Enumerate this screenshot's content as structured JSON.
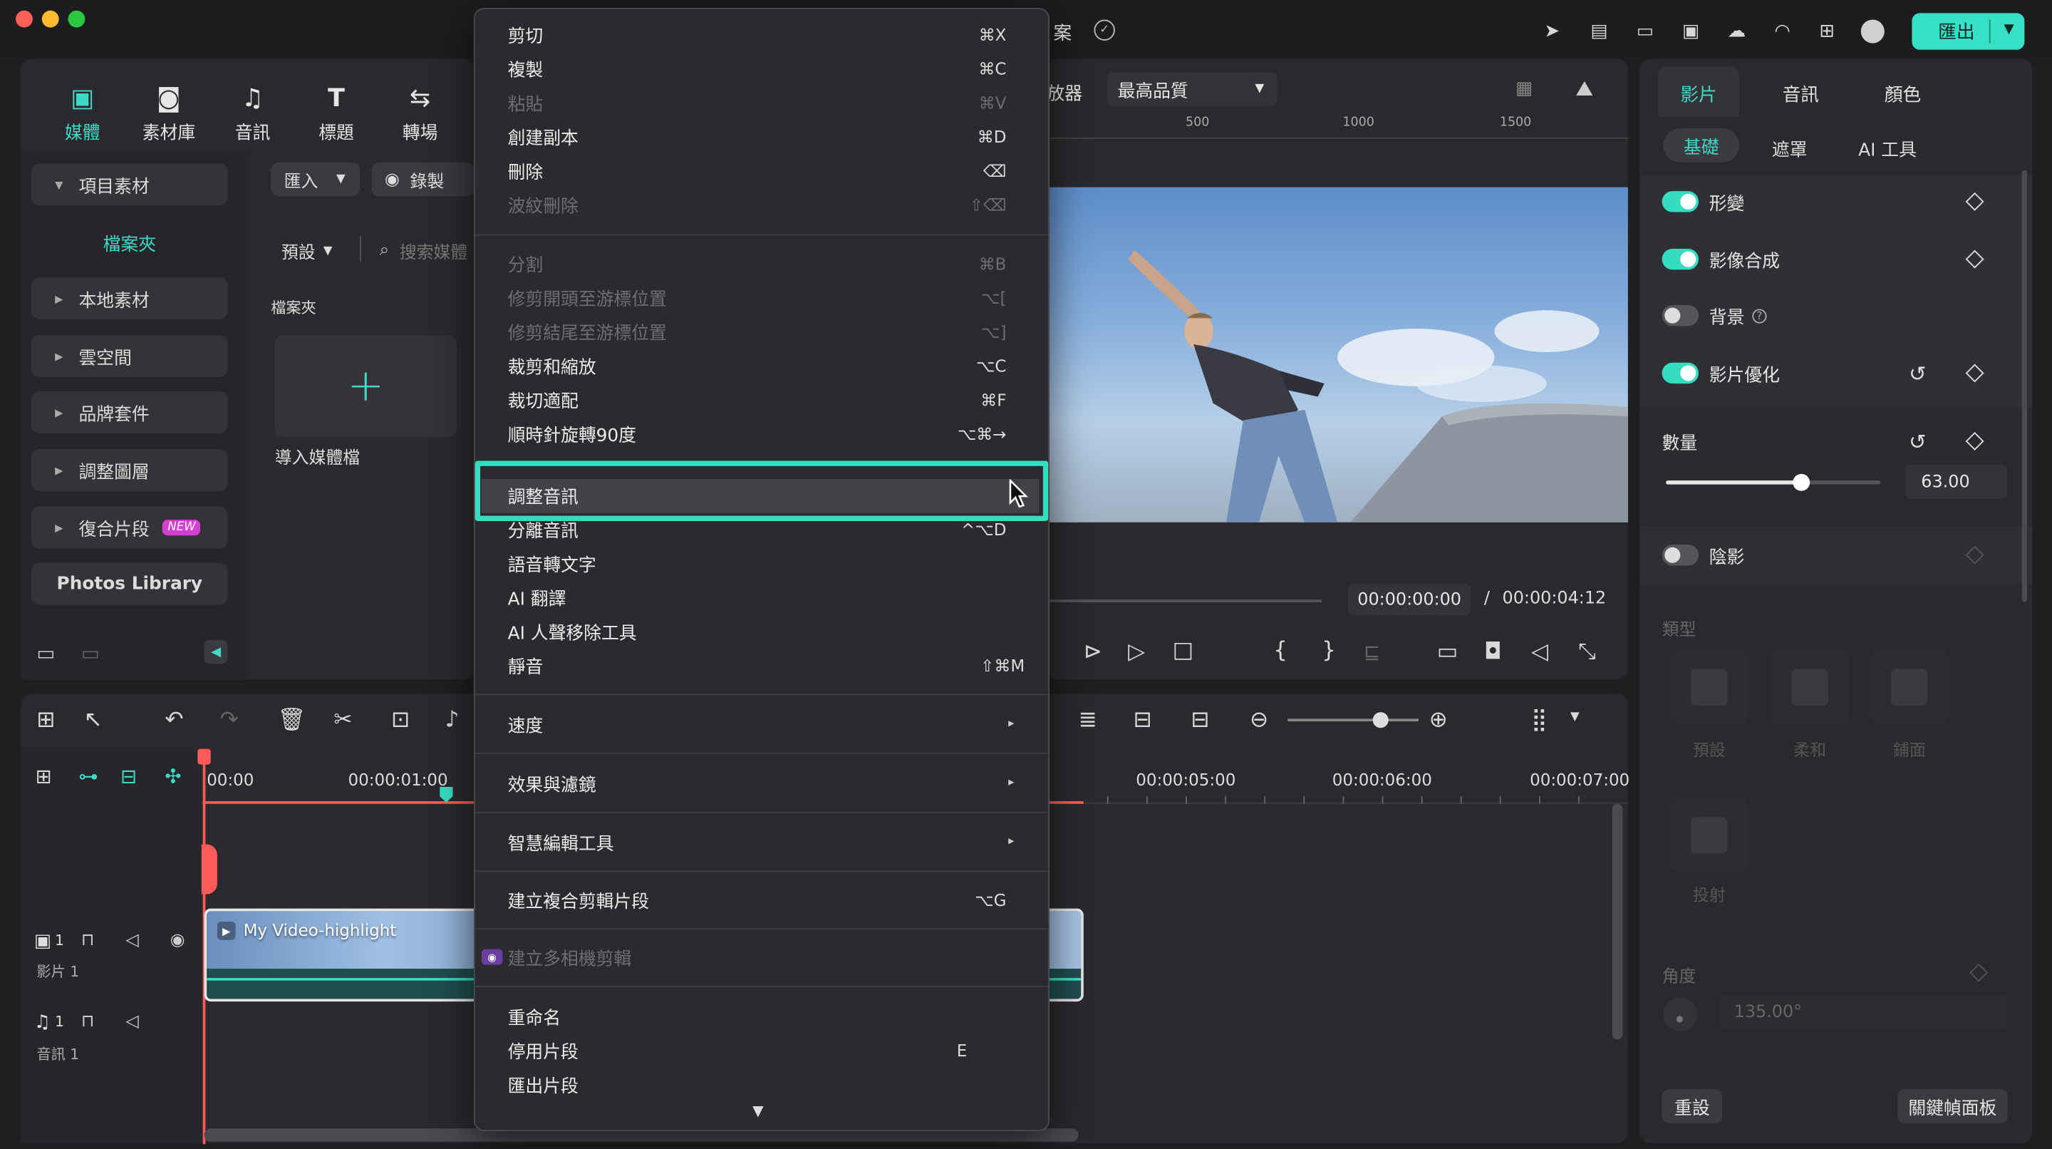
{
  "titlebar": {
    "title_fragment": "案",
    "export_label": "匯出"
  },
  "library_tabs": [
    {
      "label": "媒體",
      "icon": "media-icon"
    },
    {
      "label": "素材庫",
      "icon": "stock-icon"
    },
    {
      "label": "音訊",
      "icon": "music-note-icon"
    },
    {
      "label": "標題",
      "icon": "text-t-icon"
    },
    {
      "label": "轉場",
      "icon": "transition-icon"
    }
  ],
  "sidebar": {
    "items": [
      {
        "label": "項目素材",
        "expanded": true
      },
      {
        "label": "檔案夾",
        "sub": true
      },
      {
        "label": "本地素材"
      },
      {
        "label": "雲空間"
      },
      {
        "label": "品牌套件"
      },
      {
        "label": "調整圖層"
      },
      {
        "label": "復合片段",
        "badge": "NEW"
      },
      {
        "label": "Photos Library",
        "bold": true
      }
    ]
  },
  "media": {
    "import_label": "匯入",
    "record_label": "錄製",
    "default_label": "預設",
    "search_placeholder": "搜索媒體",
    "folder_label": "檔案夾",
    "import_media_label": "導入媒體檔"
  },
  "player": {
    "zoom_label": "放器",
    "quality": "最高品質",
    "ruler": [
      "500",
      "1000",
      "1500"
    ],
    "current_time": "00:00:00:00",
    "separator": "/",
    "total_time": "00:00:04:12",
    "brace_open": "{",
    "brace_close": "}"
  },
  "context_menu": {
    "groups": [
      [
        {
          "label": "剪切",
          "shortcut": "⌘X"
        },
        {
          "label": "複製",
          "shortcut": "⌘C"
        },
        {
          "label": "粘貼",
          "shortcut": "⌘V",
          "disabled": true
        },
        {
          "label": "創建副本",
          "shortcut": "⌘D"
        },
        {
          "label": "刪除",
          "shortcut": "⌫"
        },
        {
          "label": "波紋刪除",
          "shortcut": "⇧⌫",
          "disabled": true
        }
      ],
      [
        {
          "label": "分割",
          "shortcut": "⌘B",
          "disabled": true
        },
        {
          "label": "修剪開頭至游標位置",
          "shortcut": "⌥[",
          "disabled": true
        },
        {
          "label": "修剪結尾至游標位置",
          "shortcut": "⌥]",
          "disabled": true
        },
        {
          "label": "裁剪和縮放",
          "shortcut": "⌥C"
        },
        {
          "label": "裁切適配",
          "shortcut": "⌘F"
        },
        {
          "label": "順時針旋轉90度",
          "shortcut": "⌥⌘→"
        }
      ],
      [
        {
          "label": "調整音訊",
          "shortcut": "",
          "highlighted": true
        },
        {
          "label": "分離音訊",
          "shortcut": "^⌥D"
        },
        {
          "label": "語音轉文字",
          "shortcut": ""
        },
        {
          "label": "AI 翻譯",
          "shortcut": ""
        },
        {
          "label": "AI 人聲移除工具",
          "shortcut": ""
        },
        {
          "label": "靜音",
          "shortcut": "⇧⌘M"
        }
      ],
      [
        {
          "label": "速度",
          "submenu": true
        }
      ],
      [
        {
          "label": "效果與濾鏡",
          "submenu": true
        }
      ],
      [
        {
          "label": "智慧編輯工具",
          "submenu": true
        }
      ],
      [
        {
          "label": "建立複合剪輯片段",
          "shortcut": "⌥G"
        }
      ],
      [
        {
          "label": "建立多相機剪輯",
          "disabled": true,
          "icon": "multicam-icon"
        }
      ],
      [
        {
          "label": "重命名",
          "shortcut": ""
        },
        {
          "label": "停用片段",
          "shortcut": "E"
        },
        {
          "label": "匯出片段",
          "shortcut": ""
        }
      ]
    ],
    "more_arrow": "▼"
  },
  "right_panel": {
    "tabs": [
      "影片",
      "音訊",
      "顏色"
    ],
    "subtabs": [
      "基礎",
      "遮罩",
      "AI 工具"
    ],
    "props": [
      {
        "label": "形變",
        "on": true
      },
      {
        "label": "影像合成",
        "on": true
      },
      {
        "label": "背景",
        "on": false,
        "help": "?"
      },
      {
        "label": "影片優化",
        "on": true
      }
    ],
    "amount_label": "數量",
    "amount_value": "63.00",
    "amount_fraction": 0.63,
    "shadow_label": "陰影",
    "type_label": "類型",
    "type_options": [
      "預設",
      "柔和",
      "鋪面",
      "投射"
    ],
    "angle_label": "角度",
    "angle_value": "135.00°",
    "reset_label": "重設",
    "keyframe_label": "關鍵幀面板"
  },
  "timeline": {
    "times": [
      "00:00",
      "00:00:01:00",
      "00:00:05:00",
      "00:00:06:00",
      "00:00:07:00"
    ],
    "clip_title": "My Video-highlight",
    "video_track_label": "影片 1",
    "audio_track_label": "音訊 1",
    "video_track_num": "1",
    "audio_track_num": "1"
  },
  "colors": {
    "accent": "#36dcc0",
    "playhead": "#ff5a5a",
    "menu_bg": "#2b2b2f"
  }
}
